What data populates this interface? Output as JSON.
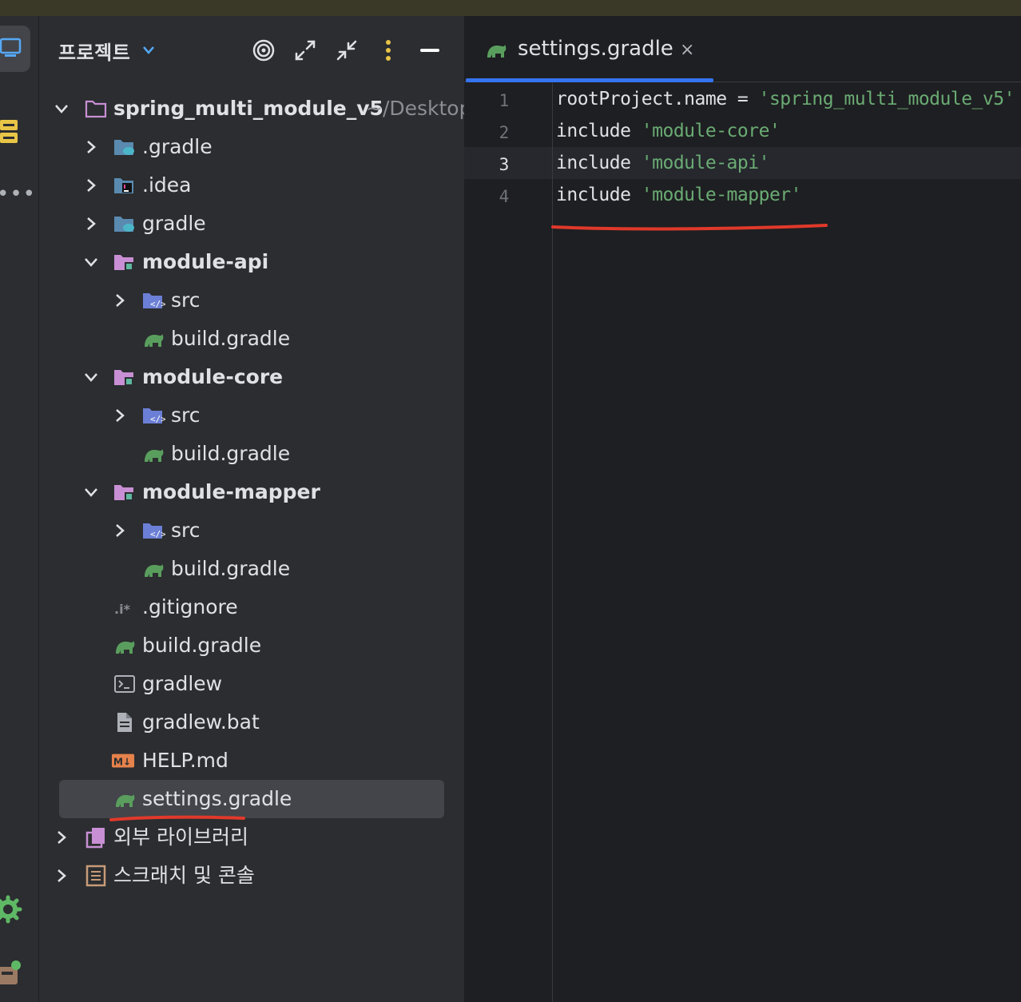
{
  "colors": {
    "accent": "#3574f0",
    "string": "#6aab73",
    "annotation": "#e0392b",
    "gradle": "#5a9e5e",
    "module": "#c88fd4"
  },
  "panel": {
    "title": "프로젝트"
  },
  "tree": {
    "root": {
      "label": "spring_multi_module_v5",
      "hint": "~/Desktop"
    },
    "items": [
      {
        "label": ".gradle",
        "icon": "gradle-folder-icon"
      },
      {
        "label": ".idea",
        "icon": "idea-folder-icon"
      },
      {
        "label": "gradle",
        "icon": "gradle-folder-icon"
      },
      {
        "label": "module-api",
        "icon": "module-folder-icon"
      },
      {
        "label": "src",
        "icon": "source-folder-icon"
      },
      {
        "label": "build.gradle",
        "icon": "gradle-file-icon"
      },
      {
        "label": "module-core",
        "icon": "module-folder-icon"
      },
      {
        "label": "src",
        "icon": "source-folder-icon"
      },
      {
        "label": "build.gradle",
        "icon": "gradle-file-icon"
      },
      {
        "label": "module-mapper",
        "icon": "module-folder-icon"
      },
      {
        "label": "src",
        "icon": "source-folder-icon"
      },
      {
        "label": "build.gradle",
        "icon": "gradle-file-icon"
      },
      {
        "label": ".gitignore",
        "icon": "ignore-file-icon"
      },
      {
        "label": "build.gradle",
        "icon": "gradle-file-icon"
      },
      {
        "label": "gradlew",
        "icon": "terminal-file-icon"
      },
      {
        "label": "gradlew.bat",
        "icon": "text-file-icon"
      },
      {
        "label": "HELP.md",
        "icon": "markdown-file-icon"
      },
      {
        "label": "settings.gradle",
        "icon": "gradle-file-icon"
      }
    ],
    "external_libraries": "외부 라이브러리",
    "scratches": "스크래치 및 콘솔"
  },
  "editor": {
    "tab": {
      "label": "settings.gradle",
      "close": "×"
    },
    "line_numbers": [
      "1",
      "2",
      "3",
      "4"
    ],
    "lines": [
      {
        "plain": "rootProject.name = ",
        "str": "'spring_multi_module_v5'"
      },
      {
        "plain": "include ",
        "str": "'module-core'"
      },
      {
        "plain": "include ",
        "str": "'module-api'"
      },
      {
        "plain": "include ",
        "str": "'module-mapper'"
      }
    ]
  }
}
